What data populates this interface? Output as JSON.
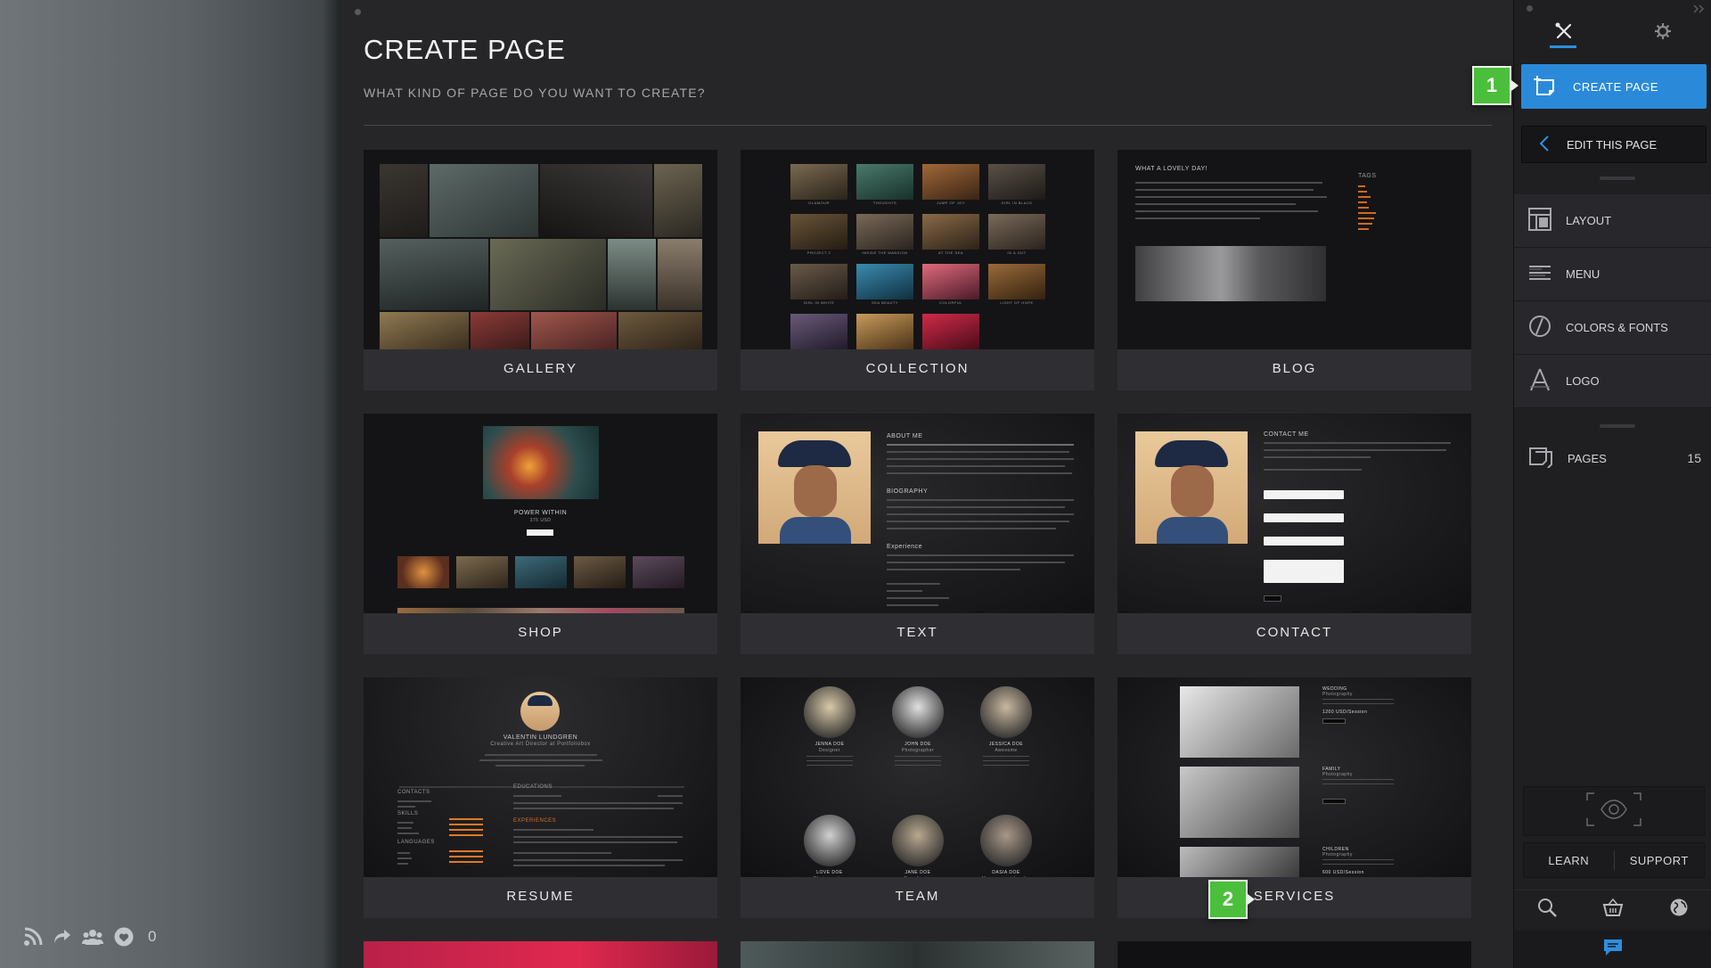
{
  "main": {
    "title": "CREATE PAGE",
    "subtitle": "WHAT KIND OF PAGE DO YOU WANT TO CREATE?",
    "templates": [
      {
        "label": "GALLERY"
      },
      {
        "label": "COLLECTION"
      },
      {
        "label": "BLOG"
      },
      {
        "label": "SHOP"
      },
      {
        "label": "TEXT"
      },
      {
        "label": "CONTACT"
      },
      {
        "label": "RESUME"
      },
      {
        "label": "TEAM"
      },
      {
        "label": "SERVICES"
      }
    ]
  },
  "thumbs": {
    "blog_heading": "WHAT A LOVELY DAY!",
    "blog_tags": "TAGS",
    "shop_product": "POWER WITHIN",
    "shop_price": "375 USD",
    "text_about": "ABOUT ME",
    "text_bio": "BIOGRAPHY",
    "text_experience": "Experience",
    "contact_heading": "CONTACT ME",
    "resume_name": "VALENTIN LUNDGREN",
    "resume_role": "Creative Art Director at Portfoliobox",
    "resume_contacts": "CONTACTS",
    "resume_skills": "SKILLS",
    "resume_languages": "LANGUAGES",
    "resume_education": "EDUCATIONS",
    "resume_experiences": "EXPERIENCES",
    "team_members": [
      {
        "name": "JENNA DOE",
        "role": "Designer"
      },
      {
        "name": "JOHN DOE",
        "role": "Photographer"
      },
      {
        "name": "JESSICA DOE",
        "role": "Awesome"
      },
      {
        "name": "LOVE DOE",
        "role": "Photographer"
      },
      {
        "name": "JANE DOE",
        "role": "Coordinator"
      },
      {
        "name": "DASIA DOE",
        "role": "Management Leader"
      }
    ],
    "services": [
      {
        "title": "WEDDING",
        "sub": "Photography",
        "price": "1200 USD/Session"
      },
      {
        "title": "FAMILY",
        "sub": "Photography",
        "price": ""
      },
      {
        "title": "CHILDREN",
        "sub": "Photography",
        "price": "600 USD/Session"
      }
    ],
    "collection_captions": [
      "GLAMOUR",
      "THOUGHTS",
      "JUMP OF JOY",
      "GIRL IN BLACK",
      "PROJECT 2",
      "INSIDE THE MANSION",
      "AT THE SEA",
      "IN & OUT",
      "GIRL IN WHITE",
      "SEA BEAUTY",
      "COLORFUL",
      "LIGHT OF HOPE"
    ]
  },
  "panel": {
    "create_page": "CREATE PAGE",
    "edit_page": "EDIT THIS PAGE",
    "menu": [
      {
        "label": "LAYOUT",
        "icon": "layout-icon"
      },
      {
        "label": "MENU",
        "icon": "menu-lines-icon"
      },
      {
        "label": "COLORS & FONTS",
        "icon": "colors-fonts-icon"
      },
      {
        "label": "LOGO",
        "icon": "logo-icon"
      }
    ],
    "pages_label": "PAGES",
    "pages_count": "15",
    "learn": "LEARN",
    "support": "SUPPORT"
  },
  "callouts": {
    "one": "1",
    "two": "2"
  },
  "footer": {
    "likes": "0"
  },
  "colors": {
    "accent": "#2a8ad9",
    "callout": "#4bbf3c",
    "panel": "#1f1f22",
    "main": "#262629"
  }
}
